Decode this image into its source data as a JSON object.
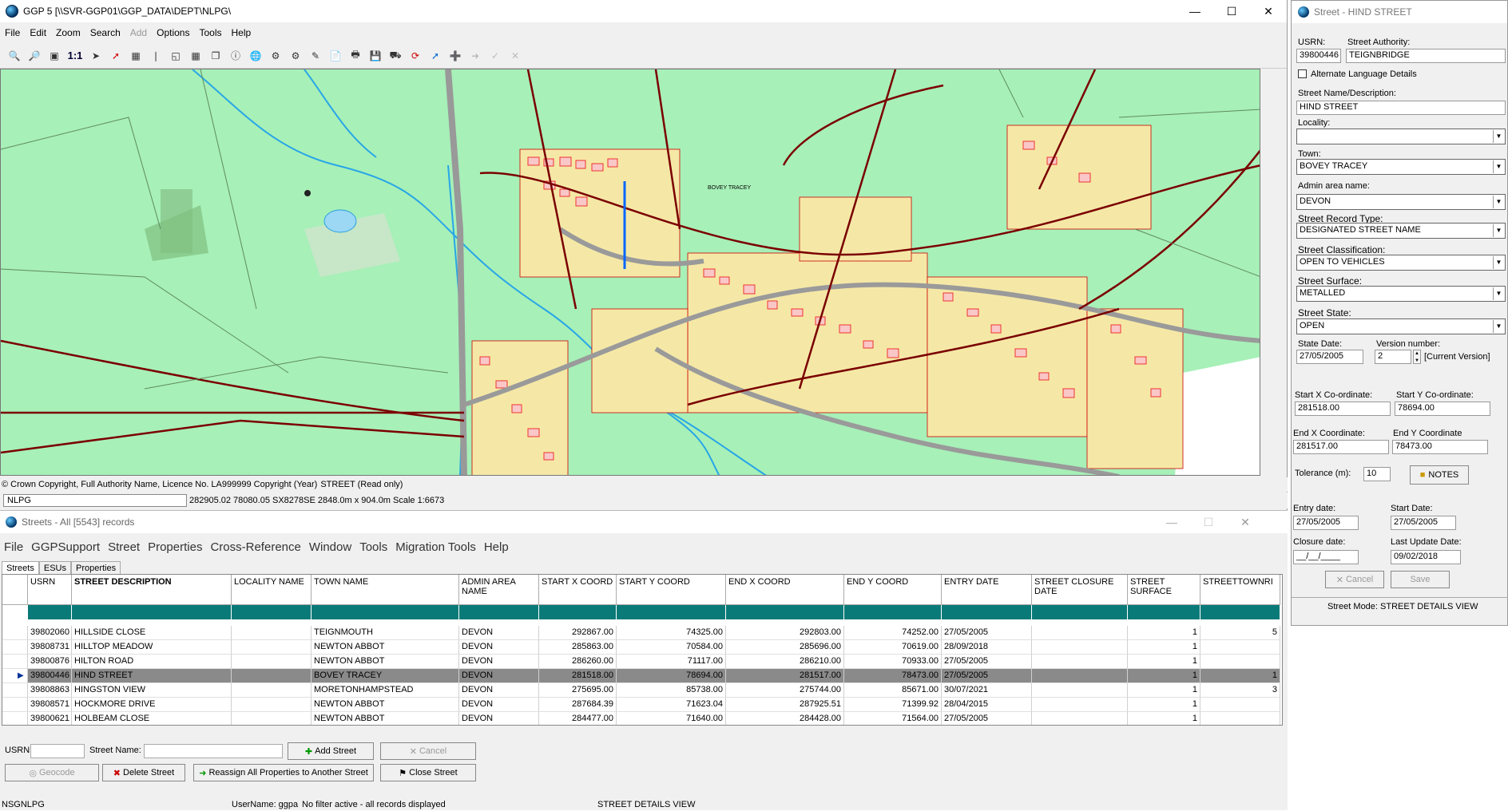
{
  "main_window": {
    "title": "GGP 5 [\\\\SVR-GGP01\\GGP_DATA\\DEPT\\NLPG\\",
    "menu": [
      "File",
      "Edit",
      "Zoom",
      "Search",
      "Add",
      "Options",
      "Tools",
      "Help"
    ],
    "copyright": "© Crown Copyright, Full Authority Name, Licence No. LA999999 Copyright (Year)",
    "layer_status": "STREET (Read only)",
    "layer_name": "NLPG",
    "coord_readout": "282905.02 78080.05 SX8278SE 2848.0m x 904.0m Scale 1:6673",
    "map_label": "BOVEY TRACEY",
    "toolbar_scale_label": "1:1"
  },
  "streets_window": {
    "title": "Streets - All [5543] records",
    "menu": [
      "File",
      "GGPSupport",
      "Street",
      "Properties",
      "Cross-Reference",
      "Window",
      "Tools",
      "Migration Tools",
      "Help"
    ],
    "tabs": [
      "Streets",
      "ESUs",
      "Properties"
    ],
    "columns": [
      "USRN",
      "STREET DESCRIPTION",
      "LOCALITY NAME",
      "TOWN NAME",
      "ADMIN AREA NAME",
      "START X COORD",
      "START Y COORD",
      "END X COORD",
      "END Y COORD",
      "ENTRY DATE",
      "STREET CLOSURE DATE",
      "STREET SURFACE",
      "STREETTOWNRI"
    ],
    "rows": [
      {
        "usrn": "39802060",
        "desc": "HILLSIDE CLOSE",
        "loc": "",
        "town": "TEIGNMOUTH",
        "admin": "DEVON",
        "sx": "292867.00",
        "sy": "74325.00",
        "ex": "292803.00",
        "ey": "74252.00",
        "date": "27/05/2005",
        "closure": "",
        "surface": "1",
        "extra": "5"
      },
      {
        "usrn": "39808731",
        "desc": "HILLTOP MEADOW",
        "loc": "",
        "town": "NEWTON ABBOT",
        "admin": "DEVON",
        "sx": "285863.00",
        "sy": "70584.00",
        "ex": "285696.00",
        "ey": "70619.00",
        "date": "28/09/2018",
        "closure": "",
        "surface": "1",
        "extra": ""
      },
      {
        "usrn": "39800876",
        "desc": "HILTON ROAD",
        "loc": "",
        "town": "NEWTON ABBOT",
        "admin": "DEVON",
        "sx": "286260.00",
        "sy": "71117.00",
        "ex": "286210.00",
        "ey": "70933.00",
        "date": "27/05/2005",
        "closure": "",
        "surface": "1",
        "extra": ""
      },
      {
        "usrn": "39800446",
        "desc": "HIND STREET",
        "loc": "",
        "town": "BOVEY TRACEY",
        "admin": "DEVON",
        "sx": "281518.00",
        "sy": "78694.00",
        "ex": "281517.00",
        "ey": "78473.00",
        "date": "27/05/2005",
        "closure": "",
        "surface": "1",
        "extra": "1"
      },
      {
        "usrn": "39808863",
        "desc": "HINGSTON VIEW",
        "loc": "",
        "town": "MORETONHAMPSTEAD",
        "admin": "DEVON",
        "sx": "275695.00",
        "sy": "85738.00",
        "ex": "275744.00",
        "ey": "85671.00",
        "date": "30/07/2021",
        "closure": "",
        "surface": "1",
        "extra": "3"
      },
      {
        "usrn": "39808571",
        "desc": "HOCKMORE DRIVE",
        "loc": "",
        "town": "NEWTON ABBOT",
        "admin": "DEVON",
        "sx": "287684.39",
        "sy": "71623.04",
        "ex": "287925.51",
        "ey": "71399.92",
        "date": "28/04/2015",
        "closure": "",
        "surface": "1",
        "extra": ""
      },
      {
        "usrn": "39800621",
        "desc": "HOLBEAM CLOSE",
        "loc": "",
        "town": "NEWTON ABBOT",
        "admin": "DEVON",
        "sx": "284477.00",
        "sy": "71640.00",
        "ex": "284428.00",
        "ey": "71564.00",
        "date": "27/05/2005",
        "closure": "",
        "surface": "1",
        "extra": ""
      }
    ],
    "form": {
      "usrn_label": "USRN:",
      "street_name_label": "Street Name:",
      "add_street": "Add Street",
      "cancel": "Cancel",
      "geocode": "Geocode",
      "delete_street": "Delete Street",
      "reassign": "Reassign All Properties to Another Street",
      "close_street": "Close Street"
    },
    "status": {
      "db": "NSGNLPG",
      "user": "UserName: ggpa",
      "filter": "No filter active - all records displayed",
      "mode": "STREET DETAILS VIEW"
    }
  },
  "street_panel": {
    "title": "Street - HIND STREET",
    "usrn_label": "USRN:",
    "usrn": "39800446",
    "authority_label": "Street Authority:",
    "authority": "TEIGNBRIDGE",
    "alt_lang": "Alternate Language Details",
    "name_label": "Street Name/Description:",
    "name": "HIND STREET",
    "locality_label": "Locality:",
    "locality": "",
    "town_label": "Town:",
    "town": "BOVEY TRACEY",
    "admin_label": "Admin area name:",
    "admin": "DEVON",
    "record_type_label": "Street Record Type:",
    "record_type": "DESIGNATED STREET NAME",
    "classification_label": "Street Classification:",
    "classification": "OPEN TO VEHICLES",
    "surface_label": "Street Surface:",
    "surface": "METALLED",
    "state_label": "Street State:",
    "state": "OPEN",
    "state_date_label": "State Date:",
    "state_date": "27/05/2005",
    "version_label": "Version number:",
    "version": "2",
    "version_note": "[Current Version]",
    "start_x_label": "Start X Co-ordinate:",
    "start_x": "281518.00",
    "start_y_label": "Start Y Co-ordinate:",
    "start_y": "78694.00",
    "end_x_label": "End X Coordinate:",
    "end_x": "281517.00",
    "end_y_label": "End Y Coordinate",
    "end_y": "78473.00",
    "tolerance_label": "Tolerance (m):",
    "tolerance": "10",
    "notes": "NOTES",
    "entry_date_label": "Entry date:",
    "entry_date": "27/05/2005",
    "start_date_label": "Start Date:",
    "start_date": "27/05/2005",
    "closure_label": "Closure date:",
    "closure": "__/__/____",
    "last_update_label": "Last Update Date:",
    "last_update": "09/02/2018",
    "cancel": "Cancel",
    "save": "Save",
    "mode": "Street Mode:  STREET DETAILS VIEW"
  }
}
